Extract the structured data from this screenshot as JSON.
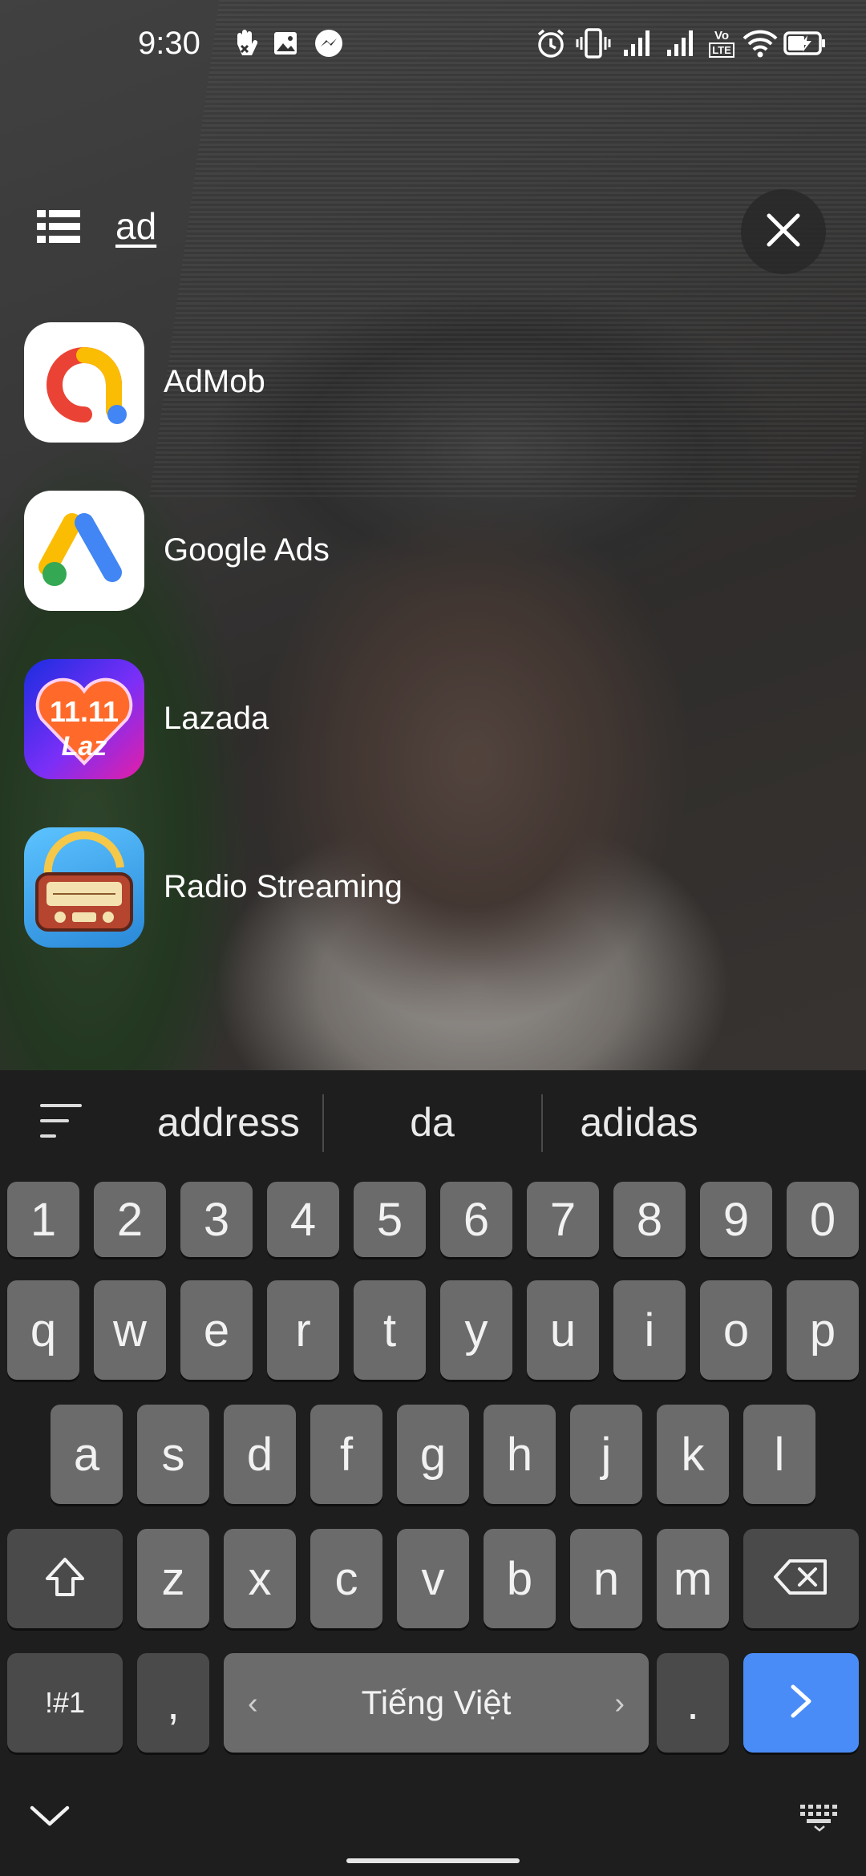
{
  "status_bar": {
    "time": "9:30",
    "icons": [
      "hand-notification-icon",
      "gallery-notification-icon",
      "messenger-notification-icon",
      "alarm-icon",
      "vibrate-icon",
      "signal-icon-1",
      "signal-icon-2",
      "volte-lte-icon",
      "wifi-icon",
      "battery-charging-icon"
    ],
    "volte_label": "Vo",
    "lte_label": "LTE"
  },
  "search": {
    "query": "ad",
    "list_icon": "list-view-icon",
    "clear_icon": "close-icon"
  },
  "results": [
    {
      "label": "AdMob",
      "icon": "admob-icon"
    },
    {
      "label": "Google Ads",
      "icon": "google-ads-icon"
    },
    {
      "label": "Lazada",
      "icon": "lazada-icon",
      "icon_text": "Laz",
      "icon_badge": "11.11"
    },
    {
      "label": "Radio Streaming",
      "icon": "radio-streaming-icon"
    }
  ],
  "keyboard": {
    "suggestions": [
      "address",
      "da",
      "adidas"
    ],
    "number_row": [
      "1",
      "2",
      "3",
      "4",
      "5",
      "6",
      "7",
      "8",
      "9",
      "0"
    ],
    "row1": [
      "q",
      "w",
      "e",
      "r",
      "t",
      "y",
      "u",
      "i",
      "o",
      "p"
    ],
    "row2": [
      "a",
      "s",
      "d",
      "f",
      "g",
      "h",
      "j",
      "k",
      "l"
    ],
    "row3": [
      "z",
      "x",
      "c",
      "v",
      "b",
      "n",
      "m"
    ],
    "symbols_key": "!#1",
    "comma_key": ",",
    "space_label": "Tiếng Việt",
    "space_left_chevron": "‹",
    "space_right_chevron": "›",
    "period_key": ".",
    "colors": {
      "accent": "#4a8cf7",
      "key": "#6b6b6b",
      "key_dark": "#4a4a4a",
      "background": "#1e1e1e"
    }
  }
}
